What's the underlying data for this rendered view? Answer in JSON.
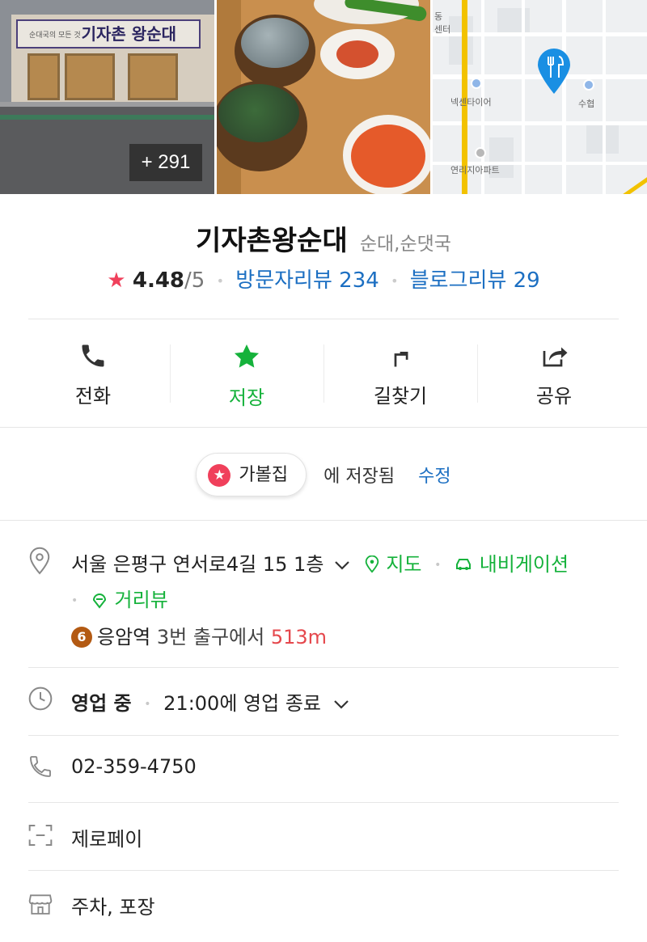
{
  "photos": {
    "more_count": "+ 291",
    "storefront_sign": "기자촌 왕순대",
    "storefront_sign_small": "순대국의 모든 것",
    "map_labels": [
      "넥센타이어",
      "수협",
      "연리지아파트",
      "동",
      "센터"
    ]
  },
  "place": {
    "name": "기자촌왕순대",
    "category": "순대,순댓국",
    "rating": "4.48",
    "rating_max": "/5",
    "visitor_reviews": "방문자리뷰 234",
    "blog_reviews": "블로그리뷰 29"
  },
  "actions": [
    {
      "label": "전화",
      "icon": "phone-icon"
    },
    {
      "label": "저장",
      "icon": "star-icon"
    },
    {
      "label": "길찾기",
      "icon": "directions-icon"
    },
    {
      "label": "공유",
      "icon": "share-icon"
    }
  ],
  "saved": {
    "folder": "가볼집",
    "text": "에 저장됨",
    "edit": "수정"
  },
  "address": {
    "text": "서울 은평구 연서로4길 15 1층",
    "map_link": "지도",
    "navi_link": "내비게이션",
    "street_view": "거리뷰",
    "metro_line": "6",
    "station": "응암역",
    "exit": "3번 출구에서",
    "distance": "513m"
  },
  "hours": {
    "status": "영업 중",
    "detail": "21:00에 영업 종료"
  },
  "phone": "02-359-4750",
  "payment": "제로페이",
  "facilities": "주차, 포장",
  "colors": {
    "accent_green": "#15b23b",
    "link_blue": "#1c6fc2",
    "rating_red": "#f0405b",
    "distance_red": "#e5484d"
  }
}
